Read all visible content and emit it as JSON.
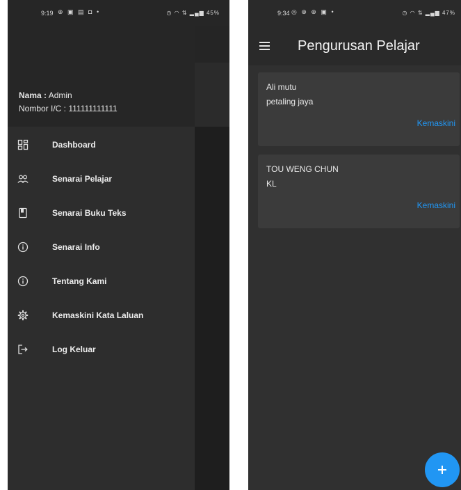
{
  "left_screen": {
    "status_bar": {
      "time": "9:19",
      "notification_icons": "⊕ ▣ ▤ ◘ •",
      "system_icons": "◷ ◠ ⇅ ▂▄▆ 45%"
    },
    "drawer": {
      "header": {
        "name_label": "Nama :",
        "name_value": "Admin",
        "ic_label": "Nombor I/C :",
        "ic_value": "111111111111"
      },
      "items": [
        {
          "label": "Dashboard",
          "icon": "dashboard-icon"
        },
        {
          "label": "Senarai Pelajar",
          "icon": "people-icon"
        },
        {
          "label": "Senarai Buku Teks",
          "icon": "book-icon"
        },
        {
          "label": "Senarai Info",
          "icon": "info-icon"
        },
        {
          "label": "Tentang Kami",
          "icon": "info-icon"
        },
        {
          "label": "Kemaskini Kata Laluan",
          "icon": "gear-icon"
        },
        {
          "label": "Log Keluar",
          "icon": "logout-icon"
        }
      ]
    }
  },
  "right_screen": {
    "status_bar": {
      "time": "9:34",
      "notification_icons": "◎ ⊕ ⊕ ▣ •",
      "system_icons": "◷ ◠ ⇅ ▂▄▆ 47%"
    },
    "app_bar": {
      "title": "Pengurusan Pelajar",
      "menu_icon": "hamburger-icon"
    },
    "students": [
      {
        "name": "Ali mutu",
        "location": "petaling jaya",
        "action": "Kemaskini"
      },
      {
        "name": "TOU WENG CHUN",
        "location": "KL",
        "action": "Kemaskini"
      }
    ],
    "fab": {
      "icon": "plus-icon"
    }
  },
  "colors": {
    "accent": "#2196f3",
    "drawer": "#2d2d2d",
    "background": "#303030",
    "card": "#3b3b3b"
  }
}
